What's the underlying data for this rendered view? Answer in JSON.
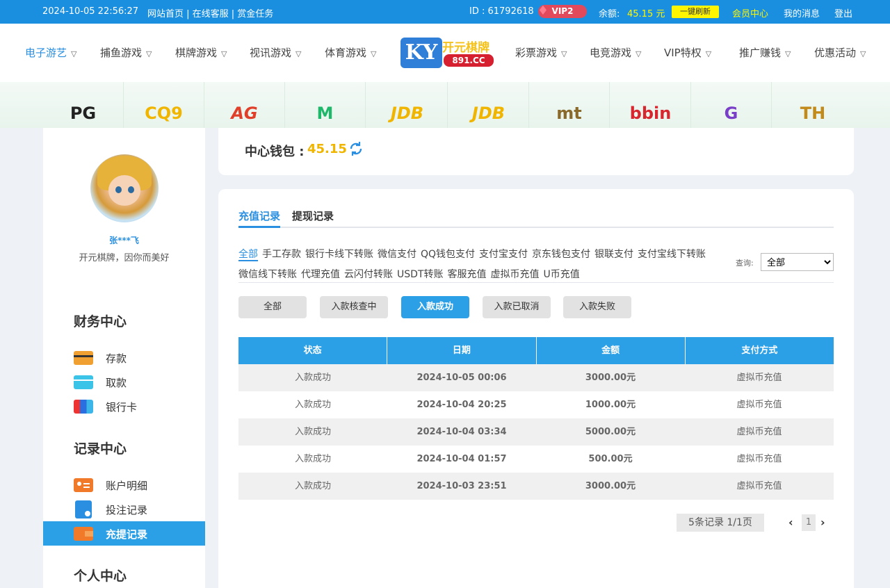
{
  "topbar": {
    "datetime": "2024-10-05 22:56:27",
    "links": "网站首页 | 在线客服 | 赏金任务",
    "id_text": "ID : 61792618",
    "vip": "VIP2",
    "balance_label": "余额:",
    "balance_value": "45.15 元",
    "refresh_label": "一键刷新",
    "member_center": "会员中心",
    "messages": "我的消息",
    "logout": "登出"
  },
  "nav": {
    "left": [
      "电子游艺",
      "捕鱼游戏",
      "棋牌游戏",
      "视讯游戏",
      "体育游戏"
    ],
    "right": [
      "彩票游戏",
      "电竞游戏",
      "VIP特权",
      "推广赚钱",
      "优惠活动"
    ],
    "logo_ky": "KY",
    "logo_name": "开元棋牌",
    "logo_domain": "891.CC"
  },
  "providers": [
    "PG",
    "CQ9",
    "AG",
    "M",
    "JDB",
    "JDB",
    "mt",
    "bbin",
    "G",
    "TH"
  ],
  "sidebar": {
    "username": "张***飞",
    "slogan": "开元棋牌，因你而美好",
    "finance_title": "财务中心",
    "finance_items": [
      "存款",
      "取款",
      "银行卡"
    ],
    "records_title": "记录中心",
    "records_items": [
      "账户明细",
      "投注记录",
      "充提记录"
    ],
    "personal_title": "个人中心"
  },
  "wallet": {
    "label": "中心钱包 :",
    "value": "45.15"
  },
  "records": {
    "tabs": [
      "充值记录",
      "提现记录"
    ],
    "filters": [
      "全部",
      "手工存款",
      "银行卡线下转账",
      "微信支付",
      "QQ钱包支付",
      "支付宝支付",
      "京东钱包支付",
      "银联支付",
      "支付宝线下转账",
      "微信线下转账",
      "代理充值",
      "云闪付转账",
      "USDT转账",
      "客服充值",
      "虚拟币充值",
      "U币充值"
    ],
    "query_label": "查询:",
    "query_selected": "全部",
    "status_buttons": [
      "全部",
      "入款核查中",
      "入款成功",
      "入款已取消",
      "入款失败"
    ],
    "columns": [
      "状态",
      "日期",
      "金额",
      "支付方式"
    ],
    "rows": [
      {
        "status": "入款成功",
        "date": "2024-10-05 00:06",
        "amount": "3000.00元",
        "method": "虚拟币充值"
      },
      {
        "status": "入款成功",
        "date": "2024-10-04 20:25",
        "amount": "1000.00元",
        "method": "虚拟币充值"
      },
      {
        "status": "入款成功",
        "date": "2024-10-04 03:34",
        "amount": "5000.00元",
        "method": "虚拟币充值"
      },
      {
        "status": "入款成功",
        "date": "2024-10-04 01:57",
        "amount": "500.00元",
        "method": "虚拟币充值"
      },
      {
        "status": "入款成功",
        "date": "2024-10-03 23:51",
        "amount": "3000.00元",
        "method": "虚拟币充值"
      }
    ],
    "pager_text": "5条记录  1/1页",
    "page": "1"
  },
  "colors": {
    "accent": "#2ba0e6",
    "topbar": "#1a8fe0",
    "gold": "#f0b500"
  }
}
